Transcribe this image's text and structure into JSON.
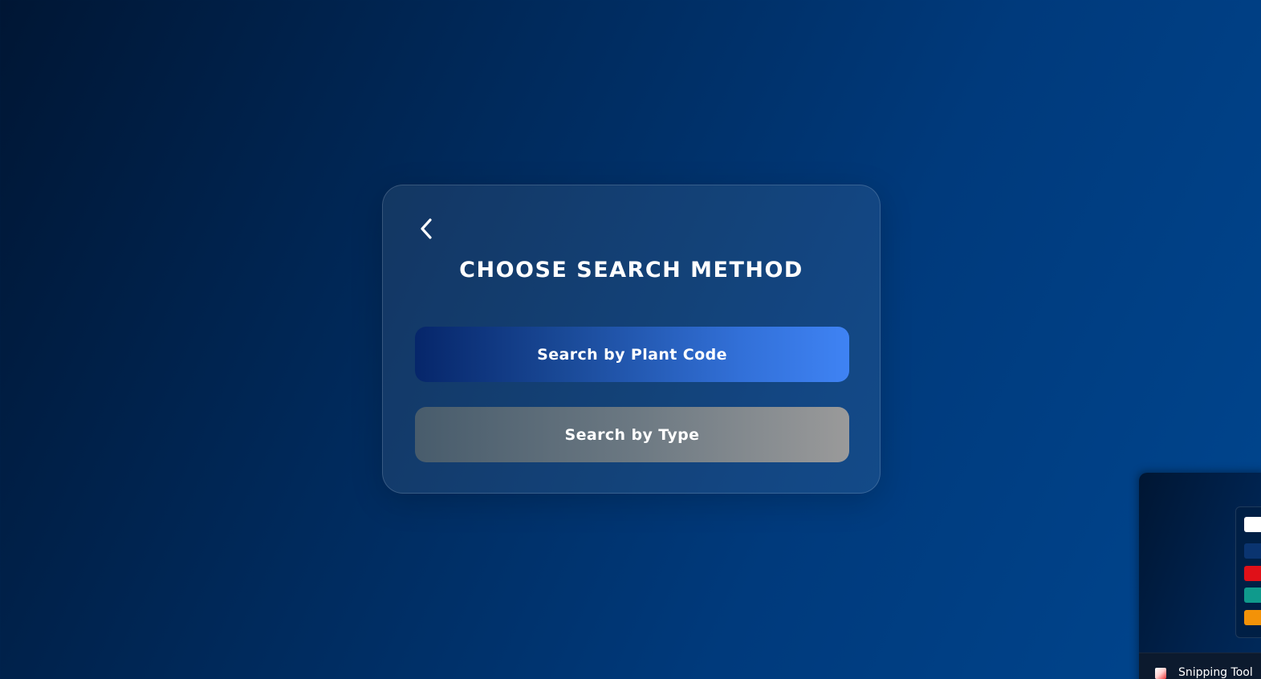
{
  "card": {
    "title": "CHOOSE SEARCH METHOD",
    "back_icon": "chevron-left-icon",
    "buttons": {
      "plant_code": "Search by Plant Code",
      "type": "Search by Type"
    }
  },
  "colors": {
    "plant_code_gradient_start": "#06266a",
    "plant_code_gradient_end": "#3f83f4",
    "type_gradient_start": "#485c6c",
    "type_gradient_end": "#9a9a9a",
    "background_dark": "#001634",
    "background_light": "#00468f"
  },
  "taskbar_popup": {
    "app_label": "Snipping Tool",
    "app_icon": "snipping-tool-icon",
    "swatch_colors": [
      "#ffffff",
      "#0a3470",
      "#e01018",
      "#0f9a8c",
      "#f39208"
    ]
  }
}
